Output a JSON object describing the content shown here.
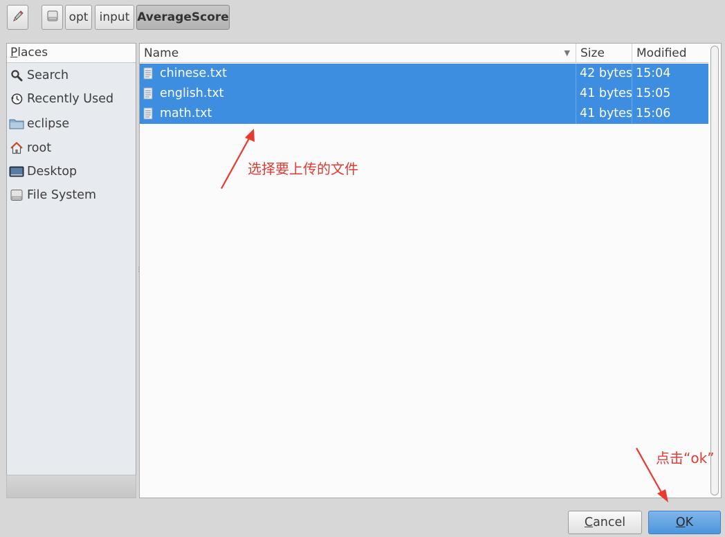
{
  "toolbar": {
    "edit_icon": "pencil-icon",
    "breadcrumbs": [
      {
        "label": "",
        "icon": "drive-icon"
      },
      {
        "label": "opt"
      },
      {
        "label": "input"
      },
      {
        "label": "AverageScore",
        "active": true
      }
    ]
  },
  "places": {
    "header_first": "P",
    "header_rest": "laces",
    "items": [
      {
        "label": "Search",
        "icon": "search-icon"
      },
      {
        "label": "Recently Used",
        "icon": "recent-icon"
      },
      {
        "label": "eclipse",
        "icon": "folder-icon"
      },
      {
        "label": "root",
        "icon": "home-icon"
      },
      {
        "label": "Desktop",
        "icon": "desktop-icon"
      },
      {
        "label": "File System",
        "icon": "drive-icon"
      }
    ]
  },
  "files": {
    "columns": {
      "name": "Name",
      "size": "Size",
      "modified": "Modified"
    },
    "rows": [
      {
        "name": "chinese.txt",
        "size": "42 bytes",
        "modified": "15:04",
        "selected": true
      },
      {
        "name": "english.txt",
        "size": "41 bytes",
        "modified": "15:05",
        "selected": true
      },
      {
        "name": "math.txt",
        "size": "41 bytes",
        "modified": "15:06",
        "selected": true
      }
    ],
    "selection_color": "#3d8ee0"
  },
  "annotations": {
    "select_files": "选择要上传的文件",
    "click_ok": "点击“ok”",
    "color": "#e23a32"
  },
  "buttons": {
    "cancel_first": "C",
    "cancel_rest": "ancel",
    "ok_first": "O",
    "ok_rest": "K"
  }
}
